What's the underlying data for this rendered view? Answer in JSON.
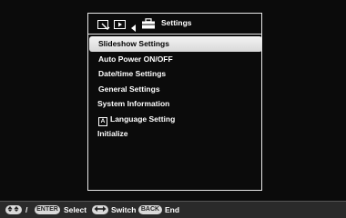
{
  "header": {
    "title": "Settings"
  },
  "menu": {
    "items": [
      {
        "label": "Slideshow Settings"
      },
      {
        "label": "Auto Power ON/OFF"
      },
      {
        "label": "Date/time Settings"
      },
      {
        "label": "General Settings"
      },
      {
        "label": "System Information"
      },
      {
        "label": "Language Setting"
      },
      {
        "label": "Initialize"
      }
    ],
    "selected_index": 0,
    "language_icon_glyph": "A"
  },
  "footer": {
    "slash": "/",
    "enter_key": "ENTER",
    "select_label": "Select",
    "switch_label": "Switch",
    "back_key": "BACK",
    "end_label": "End"
  },
  "colors": {
    "background": "#0b0b0b",
    "panel_border": "#e8e8e8",
    "selection": "#e6e6e6",
    "footer_bg": "#2a2a2a"
  },
  "icons": [
    "slideshow-settings-icon",
    "display-mode-icon",
    "left-arrow-icon",
    "toolbox-icon",
    "language-icon",
    "dpad-icon",
    "left-right-icon"
  ]
}
